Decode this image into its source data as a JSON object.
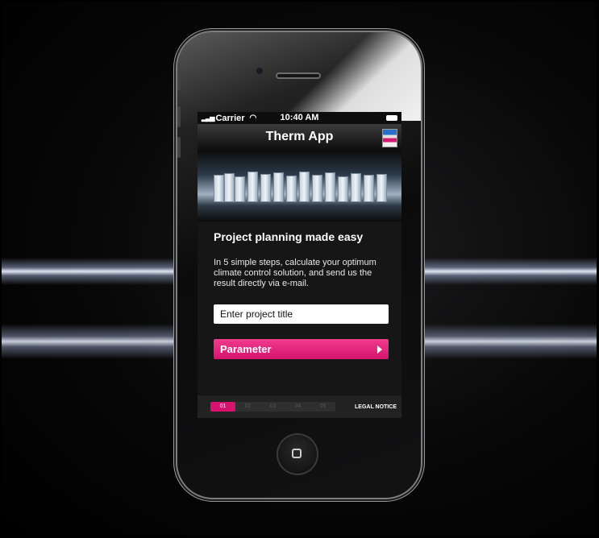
{
  "statusbar": {
    "carrier": "Carrier",
    "time": "10:40 AM"
  },
  "navbar": {
    "title": "Therm App"
  },
  "content": {
    "headline": "Project planning made easy",
    "body": "In 5 simple steps, calculate your optimum climate control solution, and send us the result directly via e-mail.",
    "input_value": "Enter project title",
    "button_label": "Parameter"
  },
  "footer": {
    "steps": [
      "01",
      "02",
      "03",
      "04",
      "05"
    ],
    "active_step": "01",
    "legal_label": "LEGAL NOTICE"
  },
  "colors": {
    "accent": "#d6126e",
    "background": "#000000"
  },
  "icons": [
    "signal-icon",
    "wifi-icon",
    "battery-icon",
    "rittal-logo-icon",
    "arrow-right-icon",
    "home-button-icon"
  ]
}
